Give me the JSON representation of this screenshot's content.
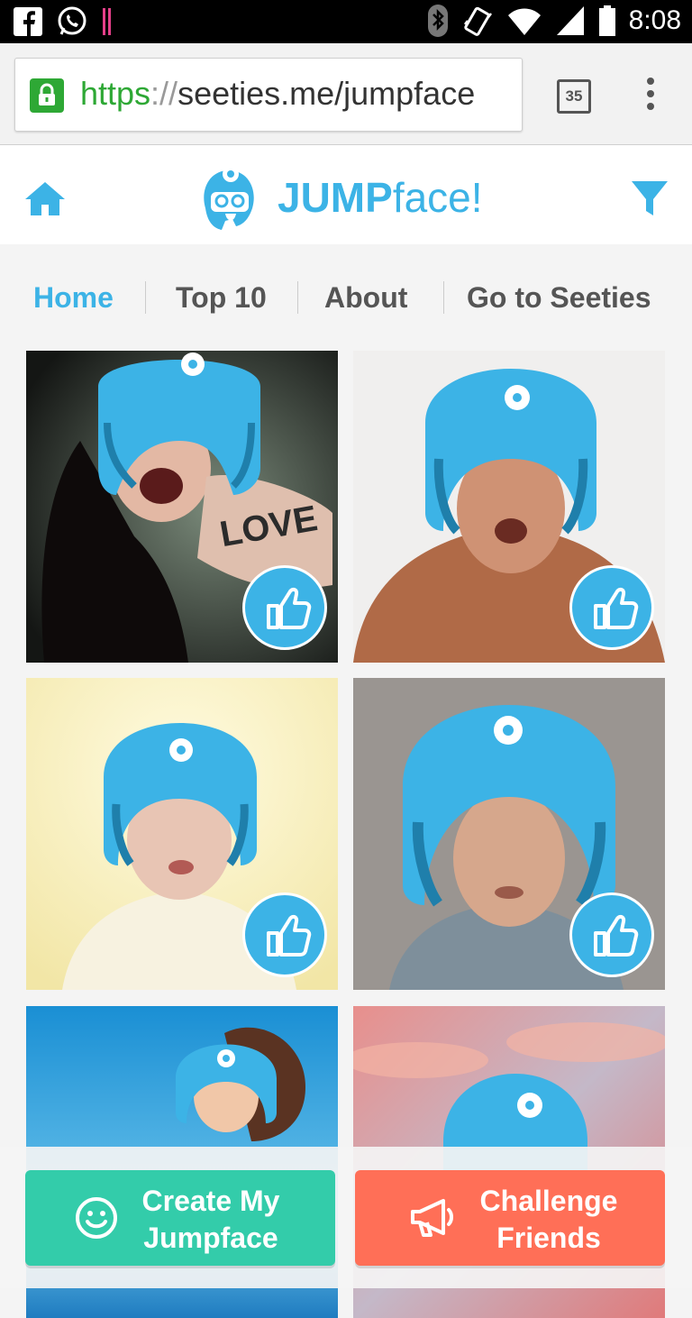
{
  "status_bar": {
    "time": "8:08",
    "icons": [
      "facebook-icon",
      "whatsapp-icon",
      "notification-bars-icon",
      "bluetooth-icon",
      "vibrate-icon",
      "wifi-icon",
      "signal-icon",
      "battery-icon"
    ]
  },
  "browser": {
    "url_scheme": "https",
    "url_separator": "://",
    "url_rest": "seeties.me/jumpface",
    "tab_count": "35"
  },
  "header": {
    "logo_bold": "JUMP",
    "logo_light": "face!",
    "brand_color": "#3cb3e6"
  },
  "nav": {
    "items": [
      {
        "label": "Home",
        "active": true
      },
      {
        "label": "Top 10",
        "active": false
      },
      {
        "label": "About",
        "active": false
      },
      {
        "label": "Go to Seeties",
        "active": false
      }
    ]
  },
  "grid": {
    "tiles": [
      {
        "photo": "woman-love-fist",
        "has_like": true
      },
      {
        "photo": "man-scrunched-face",
        "has_like": true
      },
      {
        "photo": "woman-puffed-cheeks",
        "has_like": true
      },
      {
        "photo": "man-neutral-face",
        "has_like": true
      },
      {
        "photo": "woman-beach",
        "has_like": false
      },
      {
        "photo": "sunset-sky",
        "has_like": false
      }
    ]
  },
  "actions": {
    "create_line1": "Create My",
    "create_line2": "Jumpface",
    "create_color": "#33ccaa",
    "challenge_line1": "Challenge",
    "challenge_line2": "Friends",
    "challenge_color": "#ff6f57"
  }
}
